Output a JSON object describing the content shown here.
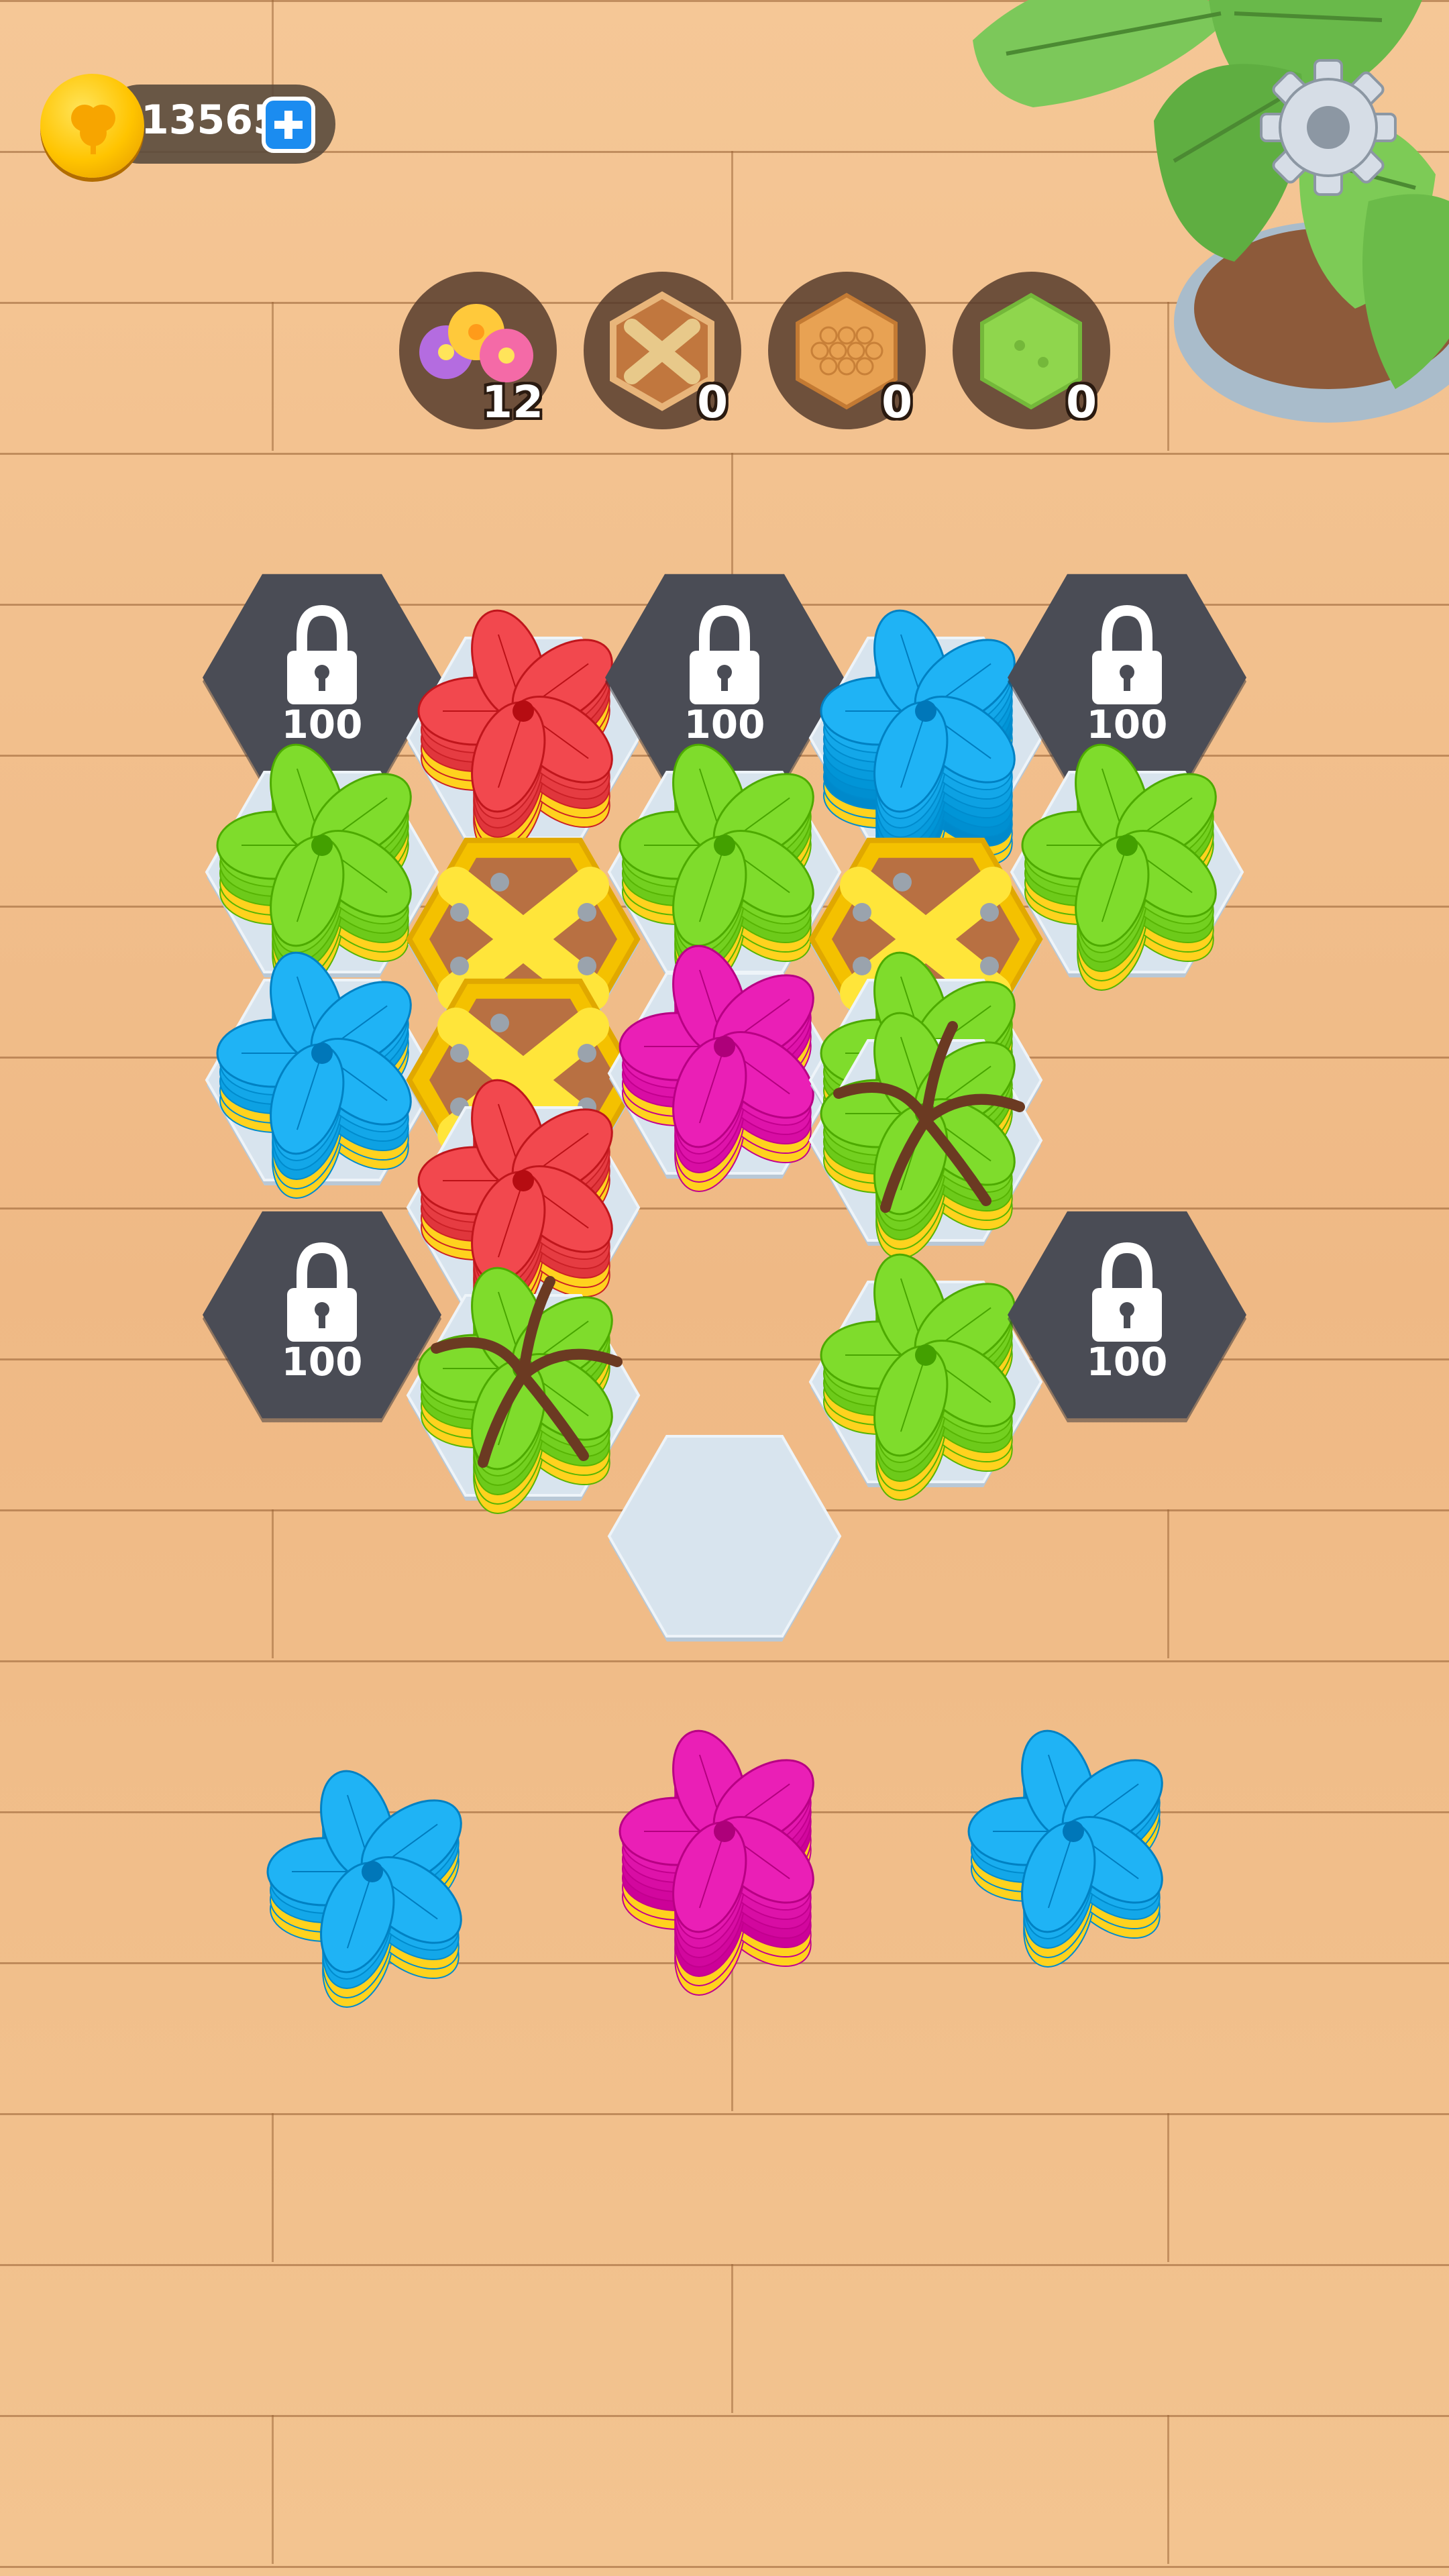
{
  "hud": {
    "coins": "13565",
    "coin_icon": "clover-coin-icon",
    "add_coins_icon": "plus-icon",
    "settings_icon": "gear-icon"
  },
  "goals": [
    {
      "icon": "flower-bouquet-icon",
      "count": "12"
    },
    {
      "icon": "wooden-crate-icon",
      "count": "0"
    },
    {
      "icon": "honeycomb-icon",
      "count": "0"
    },
    {
      "icon": "grass-tile-icon",
      "count": "0"
    }
  ],
  "locked_cells": [
    {
      "price": "100"
    },
    {
      "price": "100"
    },
    {
      "price": "100"
    },
    {
      "price": "100"
    },
    {
      "price": "100"
    }
  ],
  "board_cells": [
    {
      "content": "locked",
      "price_index": 0
    },
    {
      "content": "flower",
      "color": "red"
    },
    {
      "content": "locked",
      "price_index": 1
    },
    {
      "content": "flower",
      "color": "blue"
    },
    {
      "content": "locked",
      "price_index": 2
    },
    {
      "content": "flower",
      "color": "green"
    },
    {
      "content": "crate"
    },
    {
      "content": "flower",
      "color": "green"
    },
    {
      "content": "flower",
      "color": "blue"
    },
    {
      "content": "crate"
    },
    {
      "content": "flower",
      "color": "magenta"
    },
    {
      "content": "crate"
    },
    {
      "content": "flower",
      "color": "green"
    },
    {
      "content": "flower",
      "color": "green"
    },
    {
      "content": "flower",
      "color": "red"
    },
    {
      "content": "flower",
      "color": "green",
      "vines": true
    },
    {
      "content": "locked",
      "price_index": 3
    },
    {
      "content": "flower",
      "color": "green",
      "vines": true
    },
    {
      "content": "flower",
      "color": "green"
    },
    {
      "content": "locked",
      "price_index": 4
    },
    {
      "content": "empty"
    }
  ],
  "tray": [
    {
      "color": "blue"
    },
    {
      "color": "magenta"
    },
    {
      "color": "blue"
    }
  ],
  "colors": {
    "red": "#f2484e",
    "blue": "#1fb3f5",
    "green": "#7fdc2c",
    "magenta": "#ea1fb6",
    "yellow": "#ffd21e",
    "locked_tile": "#4a4c55",
    "empty_tile": "#d8e4ee"
  }
}
